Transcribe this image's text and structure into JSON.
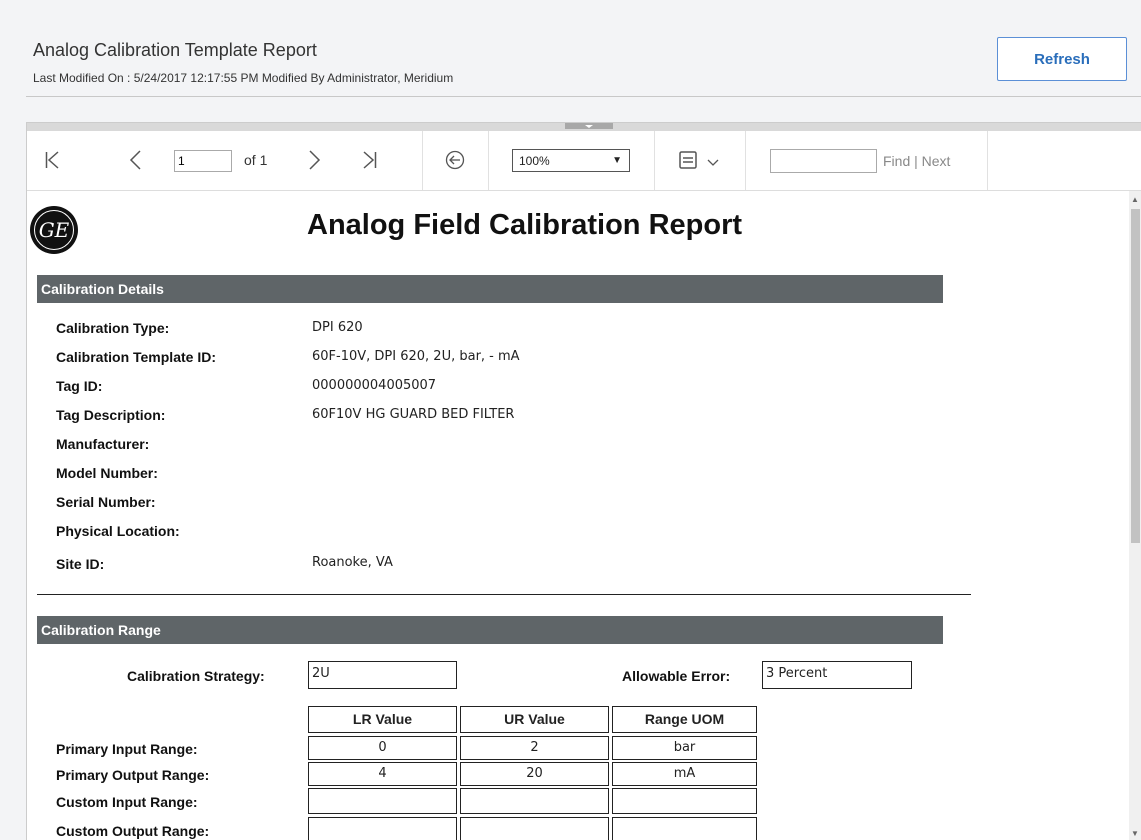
{
  "header": {
    "title": "Analog Calibration Template Report",
    "subtitle": "Last Modified On : 5/24/2017 12:17:55 PM Modified By Administrator, Meridium",
    "refresh_label": "Refresh"
  },
  "toolbar": {
    "page_value": "1",
    "page_of": "of 1",
    "zoom": "100%",
    "find_label": "Find",
    "pipe": "|",
    "next_label": "Next"
  },
  "report": {
    "title": "Analog Field Calibration Report",
    "logo_text": "GE",
    "details": {
      "section_title": "Calibration Details",
      "rows": [
        {
          "label": "Calibration Type:",
          "value": "DPI 620"
        },
        {
          "label": "Calibration Template ID:",
          "value": "60F-10V, DPI 620, 2U, bar,  - mA"
        },
        {
          "label": "Tag ID:",
          "value": "000000004005007"
        },
        {
          "label": "Tag Description:",
          "value": "60F10V HG GUARD BED FILTER"
        },
        {
          "label": "Manufacturer:",
          "value": ""
        },
        {
          "label": "Model Number:",
          "value": ""
        },
        {
          "label": "Serial Number:",
          "value": ""
        },
        {
          "label": "Physical Location:",
          "value": ""
        },
        {
          "label": "Site ID:",
          "value": "Roanoke, VA"
        }
      ]
    },
    "range": {
      "section_title": "Calibration Range",
      "strategy_label": "Calibration Strategy:",
      "strategy_value": "2U",
      "error_label": "Allowable Error:",
      "error_value": "3 Percent",
      "columns": [
        "LR Value",
        "UR Value",
        "Range UOM"
      ],
      "rows": [
        {
          "label": "Primary Input Range:",
          "cells": [
            "0",
            "2",
            "bar"
          ]
        },
        {
          "label": "Primary Output Range:",
          "cells": [
            "4",
            "20",
            "mA"
          ]
        },
        {
          "label": "Custom Input Range:",
          "cells": [
            "",
            "",
            ""
          ]
        },
        {
          "label": "Custom Output Range:",
          "cells": [
            "",
            "",
            ""
          ]
        }
      ]
    }
  }
}
